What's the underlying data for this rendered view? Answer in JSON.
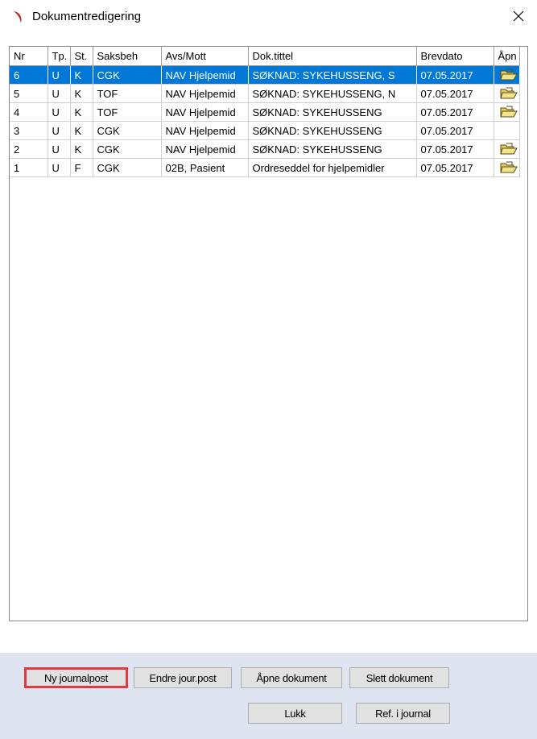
{
  "window": {
    "title": "Dokumentredigering",
    "close_glyph": "×"
  },
  "columns": [
    "Nr",
    "Tp.",
    "St.",
    "Saksbeh",
    "Avs/Mott",
    "Dok.tittel",
    "Brevdato",
    "Åpn"
  ],
  "rows": [
    {
      "nr": "6",
      "tp": "U",
      "st": "K",
      "saksbeh": "CGK",
      "avsmott": "NAV Hjelpemid",
      "tittel": "SØKNAD: SYKEHUSSENG, S",
      "dato": "07.05.2017",
      "open": true,
      "selected": true
    },
    {
      "nr": "5",
      "tp": "U",
      "st": "K",
      "saksbeh": "TOF",
      "avsmott": "NAV Hjelpemid",
      "tittel": "SØKNAD: SYKEHUSSENG, N",
      "dato": "07.05.2017",
      "open": true,
      "selected": false
    },
    {
      "nr": "4",
      "tp": "U",
      "st": "K",
      "saksbeh": "TOF",
      "avsmott": "NAV Hjelpemid",
      "tittel": "SØKNAD: SYKEHUSSENG",
      "dato": "07.05.2017",
      "open": true,
      "selected": false
    },
    {
      "nr": "3",
      "tp": "U",
      "st": "K",
      "saksbeh": "CGK",
      "avsmott": "NAV Hjelpemid",
      "tittel": "SØKNAD: SYKEHUSSENG",
      "dato": "07.05.2017",
      "open": false,
      "selected": false
    },
    {
      "nr": "2",
      "tp": "U",
      "st": "K",
      "saksbeh": "CGK",
      "avsmott": "NAV Hjelpemid",
      "tittel": "SØKNAD: SYKEHUSSENG",
      "dato": "07.05.2017",
      "open": true,
      "selected": false
    },
    {
      "nr": "1",
      "tp": "U",
      "st": "F",
      "saksbeh": "CGK",
      "avsmott": "02B, Pasient",
      "tittel": "Ordreseddel for hjelpemidler",
      "dato": "07.05.2017",
      "open": true,
      "selected": false
    }
  ],
  "buttons": {
    "new_entry": "Ny journalpost",
    "edit_entry": "Endre jour.post",
    "open_document": "Åpne dokument",
    "delete_document": "Slett dokument",
    "close": "Lukk",
    "ref_journal": "Ref. i journal"
  },
  "colors": {
    "selection": "#0078d7",
    "footer_bg": "#dee4f0",
    "highlight": "#e03a3e",
    "logo": "#c0282a"
  }
}
